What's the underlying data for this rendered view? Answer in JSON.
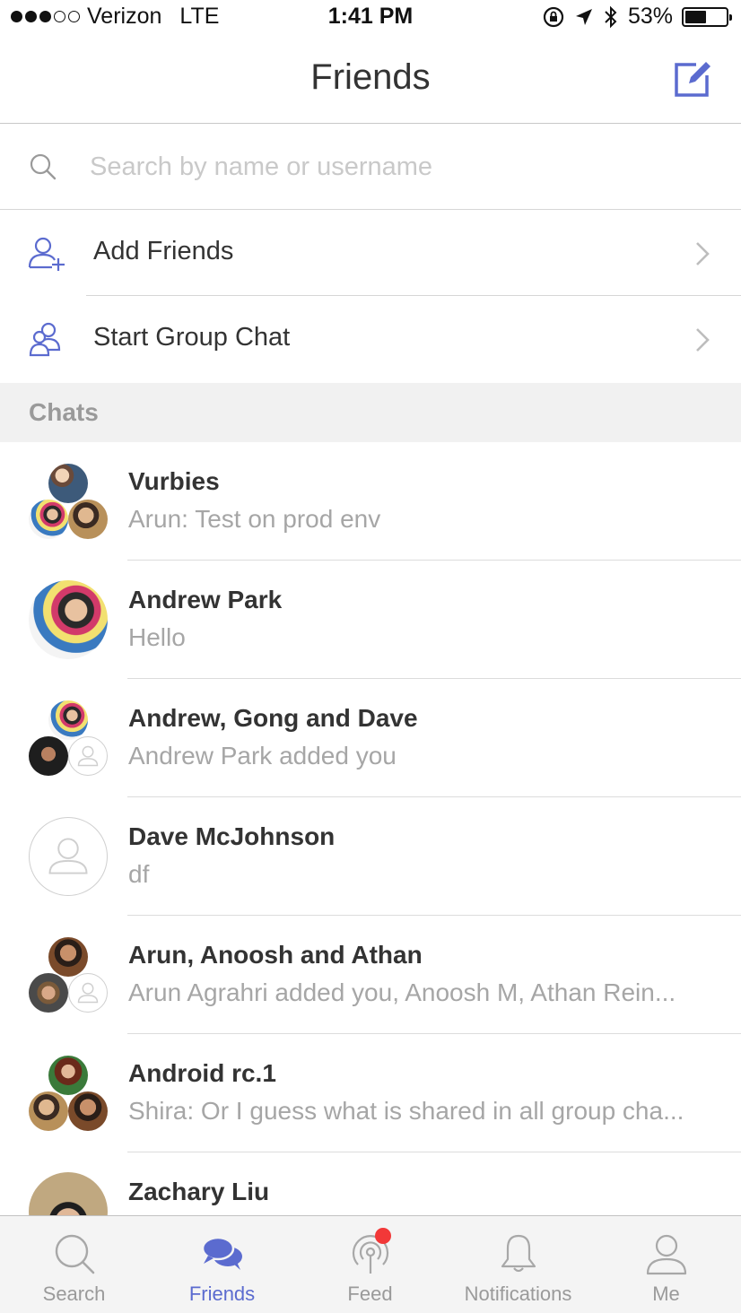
{
  "status_bar": {
    "carrier": "Verizon",
    "network": "LTE",
    "time": "1:41 PM",
    "battery": "53%",
    "battery_level": 0.53
  },
  "header": {
    "title": "Friends"
  },
  "search": {
    "placeholder": "Search by name or username"
  },
  "actions": [
    {
      "label": "Add Friends"
    },
    {
      "label": "Start Group Chat"
    }
  ],
  "section": {
    "title": "Chats"
  },
  "chats": [
    {
      "name": "Vurbies",
      "preview": "Arun: Test on prod env"
    },
    {
      "name": "Andrew Park",
      "preview": "Hello"
    },
    {
      "name": "Andrew, Gong and Dave",
      "preview": "Andrew Park added you"
    },
    {
      "name": "Dave McJohnson",
      "preview": "df"
    },
    {
      "name": "Arun, Anoosh and Athan",
      "preview": "Arun Agrahri added you, Anoosh M, Athan Rein..."
    },
    {
      "name": "Android rc.1",
      "preview": "Shira: Or I guess what is shared in all group cha..."
    },
    {
      "name": "Zachary Liu",
      "preview": ""
    }
  ],
  "tabs": [
    {
      "label": "Search",
      "icon": "search-icon"
    },
    {
      "label": "Friends",
      "icon": "chat-bubbles-icon",
      "active": true
    },
    {
      "label": "Feed",
      "icon": "broadcast-icon"
    },
    {
      "label": "Notifications",
      "icon": "bell-icon"
    },
    {
      "label": "Me",
      "icon": "person-icon"
    }
  ],
  "colors": {
    "accent": "#5b6bcf",
    "badge": "#f23838"
  }
}
